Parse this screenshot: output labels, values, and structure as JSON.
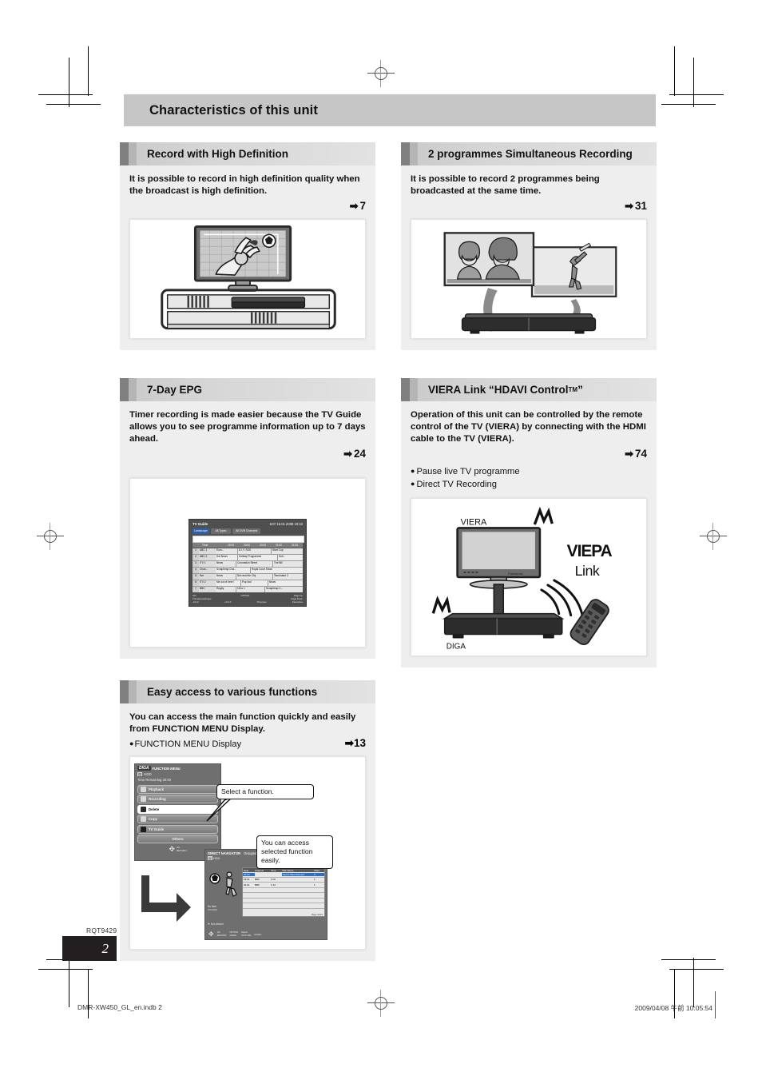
{
  "document": {
    "page_title": "Characteristics of this unit",
    "manual_code": "RQT9429",
    "page_number": "2",
    "footer_left": "DMR-XW450_GL_en.indb   2",
    "footer_right": "2009/04/08   午前 10:05:54"
  },
  "sections": [
    {
      "id": "record-hd",
      "heading": "Record with High Definition",
      "lead": "It is possible to record in high definition quality when the broadcast is high definition.",
      "page_ref": "7",
      "arrow": "➡"
    },
    {
      "id": "two-programmes",
      "heading": "2 programmes Simultaneous Recording",
      "lead": "It is possible to record 2 programmes being broadcasted at the same time.",
      "page_ref": "31",
      "arrow": "➡"
    },
    {
      "id": "epg",
      "heading": "7-Day EPG",
      "lead": "Timer recording is made easier because the TV Guide allows you to see programme information up to 7 days ahead.",
      "page_ref": "24",
      "arrow": "➡"
    },
    {
      "id": "viera-link",
      "heading_main": "VIERA Link “HDAVI Control",
      "heading_sup": "TM",
      "heading_tail": "”",
      "lead": "Operation of this unit can be controlled by the remote control of the TV (VIERA) by connecting with the HDMI cable to the TV (VIERA).",
      "page_ref": "74",
      "arrow": "➡",
      "bullets": [
        "Pause live TV programme",
        "Direct TV Recording"
      ]
    },
    {
      "id": "easy-access",
      "heading": "Easy access to various functions",
      "lead": "You can access the main function quickly and easily from FUNCTION MENU Display.",
      "inline_label": "FUNCTION MENU Display",
      "page_ref": "13",
      "arrow": "➡"
    }
  ],
  "figures": {
    "viera_link": {
      "tv_label": "VIERA",
      "recorder_label": "DIGA",
      "logo_line1": "VIEPA",
      "logo_line2": "Link"
    },
    "epg_screen": {
      "title": "TV Guide",
      "datetime": "SAT 15.01.2008 19:10",
      "filter_genre": "Landscape",
      "filter_type": "All Types",
      "filter_channel": "All  DVB Channels",
      "now_label": "Time",
      "time_slots": [
        "19:30",
        "20:00",
        "20:30",
        "21:00",
        "21:30"
      ],
      "channels": [
        {
          "no": "1",
          "name": "ABC 1",
          "programmes": [
            "Euro...",
            "D.I.Y. SOS",
            "Start Cup"
          ]
        },
        {
          "no": "2",
          "name": "ABC 2",
          "programmes": [
            "Hot News",
            "Holiday Programme",
            "Holi..."
          ]
        },
        {
          "no": "3",
          "name": "ITV 1",
          "programmes": [
            "News",
            "Coronation Street",
            "The Bill"
          ]
        },
        {
          "no": "4",
          "name": "Chan...",
          "programmes": [
            "Scrapheap Cha...",
            "Royal Court Show"
          ]
        },
        {
          "no": "5",
          "name": "five",
          "programmes": [
            "News",
            "Sex and the City",
            "Terminator 2"
          ]
        },
        {
          "no": "6",
          "name": "ITV 2",
          "programmes": [
            "Me out of here !",
            "Pop Idol",
            "News"
          ]
        },
        {
          "no": "7",
          "name": "BBC",
          "programmes": [
            "Rugby",
            "15 to 1",
            "Scrapheap C..."
          ]
        }
      ],
      "footer_keys": [
        "Info",
        "OPTION",
        "Page Up",
        "Page Down",
        "-24 Hr",
        "+24 Hr",
        "Prog.type",
        "Favourites",
        "Portrait/Landscape",
        "Select Prog."
      ]
    },
    "function_menu": {
      "brand": "DIGA",
      "title": "FUNCTION MENU",
      "drive": "HDD",
      "time_remaining": "Time Remaining  30:00",
      "items": [
        "Playback",
        "Recording",
        "Delete",
        "Copy",
        "TV Guide",
        "Others"
      ],
      "selected_item": "Delete",
      "key_ok": "OK",
      "key_return": "RETURN",
      "callout_1": "Select a function.",
      "callout_2": "You can access selected function easily."
    },
    "direct_navigator": {
      "title": "DIRECT NAVIGATOR",
      "tab": "Grouped Titles",
      "drive": "HDD",
      "time_remaining": "Time Remaining",
      "columns": [
        "Date",
        "Channel",
        "Time",
        "Title Name",
        "Titles"
      ],
      "rows": [
        {
          "date": "20.03",
          "channel": "",
          "time": "",
          "title": "Sports Best Moment",
          "titles": "3"
        },
        {
          "date": "18.01",
          "channel": "BBC",
          "time": "1:00",
          "title": "",
          "titles": "1"
        },
        {
          "date": "04.01",
          "channel": "BBC",
          "time": "1:13",
          "title": "",
          "titles": "1"
        }
      ],
      "no_label": "No Item",
      "not_viewed": "Not viewed",
      "page_label": "Page 01/01",
      "keys": [
        "OK",
        "RETURN",
        "OPTION",
        "Select",
        "VIDEO",
        "PICTURE",
        "MUSIC"
      ]
    }
  },
  "colors": {
    "title_bar": "#c6c6c6",
    "section_body": "#eeeeee",
    "tab_dark": "#808080",
    "page_badge": "#231f20"
  }
}
